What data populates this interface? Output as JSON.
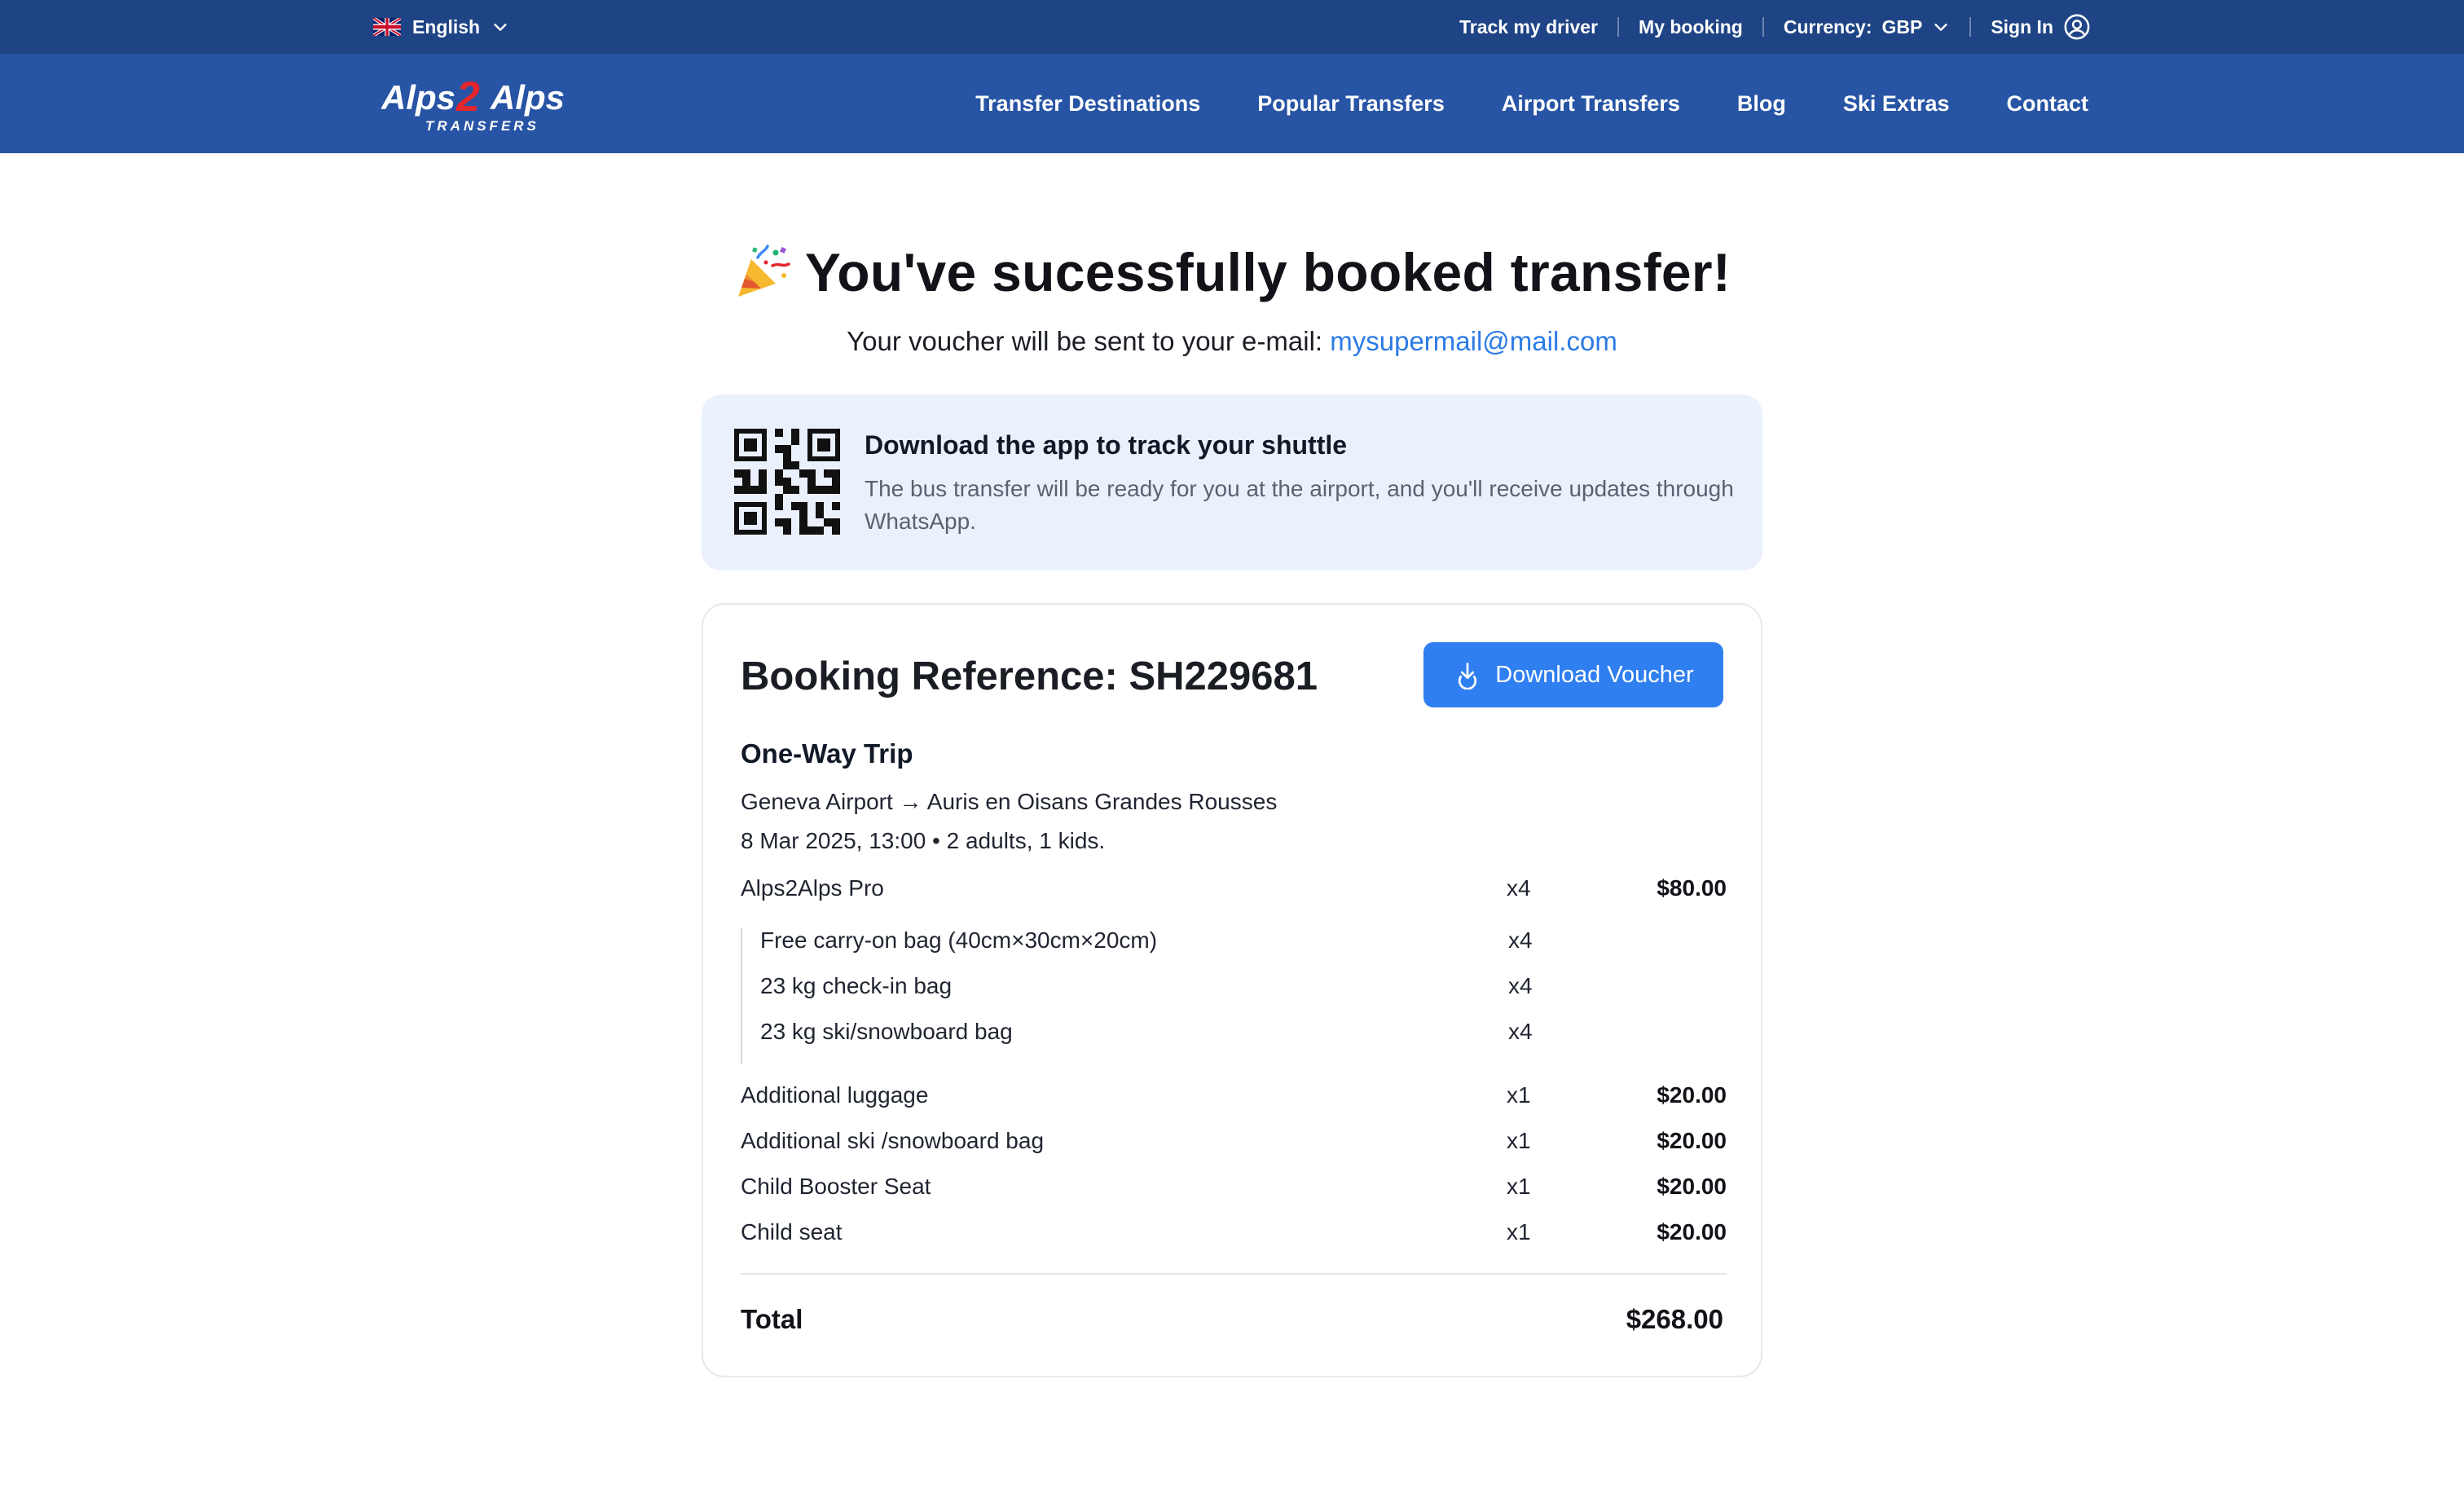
{
  "topbar": {
    "language": "English",
    "track_driver": "Track my driver",
    "my_booking": "My booking",
    "currency_label": "Currency:",
    "currency_value": "GBP",
    "sign_in": "Sign In"
  },
  "nav": {
    "logo_text_left": "Alps",
    "logo_text_mid": "2",
    "logo_text_right": "Alps",
    "logo_sub": "TRANSFERS",
    "items": [
      {
        "label": "Transfer Destinations"
      },
      {
        "label": "Popular Transfers"
      },
      {
        "label": "Airport Transfers"
      },
      {
        "label": "Blog"
      },
      {
        "label": "Ski Extras"
      },
      {
        "label": "Contact"
      }
    ]
  },
  "hero": {
    "title": "You've sucessfully booked transfer!",
    "subtitle_prefix": "Your voucher will be sent to your e-mail: ",
    "email": "mysupermail@mail.com"
  },
  "app_card": {
    "title": "Download the app to track your shuttle",
    "description": "The bus transfer will be ready for you at the airport, and you'll receive updates through WhatsApp."
  },
  "booking": {
    "reference": "Booking Reference: SH229681",
    "download_label": "Download Voucher",
    "trip_type": "One-Way Trip",
    "route": "Geneva Airport → Auris en Oisans Grandes Rousses",
    "details": "8 Mar 2025, 13:00 • 2 adults, 1 kids.",
    "main_item": {
      "label": "Alps2Alps Pro",
      "qty": "x4",
      "price": "$80.00"
    },
    "included": [
      {
        "label": "Free carry-on bag (40cm×30cm×20cm)",
        "qty": "x4"
      },
      {
        "label": "23 kg check-in bag",
        "qty": "x4"
      },
      {
        "label": "23 kg ski/snowboard bag",
        "qty": "x4"
      }
    ],
    "extras": [
      {
        "label": "Additional luggage",
        "qty": "x1",
        "price": "$20.00"
      },
      {
        "label": "Additional ski /snowboard bag",
        "qty": "x1",
        "price": "$20.00"
      },
      {
        "label": "Child Booster Seat",
        "qty": "x1",
        "price": "$20.00"
      },
      {
        "label": "Child seat",
        "qty": "x1",
        "price": "$20.00"
      }
    ],
    "total_label": "Total",
    "total_value": "$268.00"
  },
  "colors": {
    "topbar": "#1f4485",
    "navbar": "#2754a4",
    "accent": "#2f7ff0",
    "link": "#2b7be5",
    "app_card_bg": "#ebf1fc"
  },
  "icons": {
    "language": "uk-flag-icon",
    "dropdown": "chevron-down-icon",
    "user": "user-circle-icon",
    "party": "party-popper-icon",
    "qr": "qr-code-icon",
    "download": "download-icon"
  }
}
